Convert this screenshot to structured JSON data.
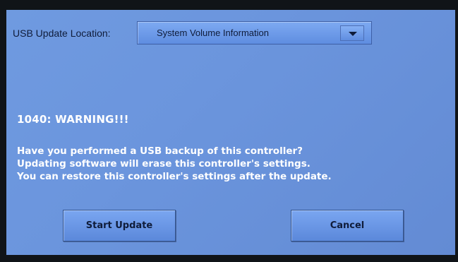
{
  "location": {
    "label": "USB Update Location:",
    "selected_value": "System Volume Information"
  },
  "warning": {
    "title": "1040: WARNING!!!",
    "lines": [
      "Have you performed a USB backup of this controller?",
      "Updating software will erase this controller's settings.",
      "You can restore this controller's settings after the update."
    ]
  },
  "buttons": {
    "start_label": "Start Update",
    "cancel_label": "Cancel"
  },
  "colors": {
    "screen_background": "#6b95dd",
    "text_white": "#ffffff",
    "text_dark": "#0f1c3a",
    "bezel": "#101418"
  },
  "icons": {
    "dropdown": "chevron-down-icon"
  }
}
